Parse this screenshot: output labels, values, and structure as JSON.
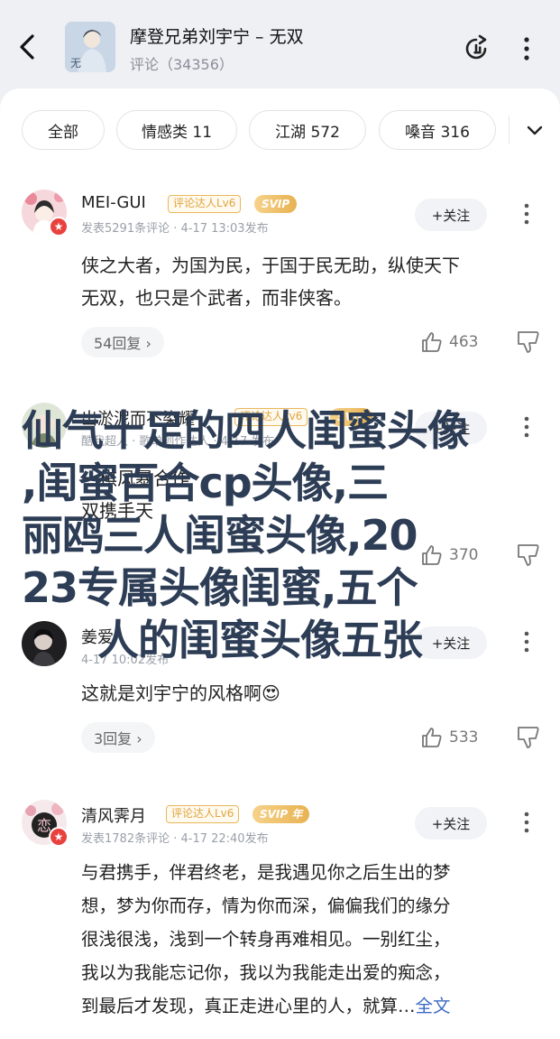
{
  "header": {
    "title": "摩登兄弟刘宇宁 – 无双",
    "subtitle": "评论（34356）"
  },
  "filters": [
    {
      "label": "全部"
    },
    {
      "label": "情感类 11"
    },
    {
      "label": "江湖 572"
    },
    {
      "label": "嗓音 316"
    }
  ],
  "comments": [
    {
      "user": "MEI-GUI",
      "level_tag": "评论达人Lv6",
      "vip_tag": "SVIP",
      "meta": "发表5291条评论 · 4-17 13:03发布",
      "follow": "+关注",
      "text_lines": [
        "侠之大者，为国为民，于国于民无助，纵使天下",
        "无双，也只是个武者，而非侠客。"
      ],
      "replies": "54回复 ›",
      "likes": "463"
    },
    {
      "user": "出淤泥而不染耀",
      "level_tag": "评论达人Lv6",
      "vip_tag": "SVIP",
      "meta": "酷我超人 · 歌单创作达人 · 4-17 发布",
      "follow": "+关注",
      "text_lines": [
        "一棋风暴合作",
        "双携手天"
      ],
      "replies": "",
      "likes": "370"
    },
    {
      "user": "姜爱",
      "level_tag": "",
      "vip_tag": "",
      "meta": "4-17 10:02发布",
      "follow": "+关注",
      "text_lines": [
        "这就是刘宇宁的风格啊😍"
      ],
      "replies": "3回复 ›",
      "likes": "533"
    },
    {
      "user": "清风霁月",
      "level_tag": "评论达人Lv6",
      "vip_tag": "SVIP 年",
      "meta": "发表1782条评论 · 4-17 22:40发布",
      "follow": "+关注",
      "text_lines": [
        "与君携手，伴君终老，是我遇见你之后生出的梦",
        "想，梦为你而存，情为你而深，偏偏我们的缘分",
        "很浅很浅，浅到一个转身再难相见。一别红尘，",
        "我以为我能忘记你，我以为我能走出爱的痴念，",
        "到最后才发现，真正走进心里的人，就算…"
      ],
      "full_link": "全文",
      "replies": "",
      "likes": ""
    }
  ],
  "overlay": {
    "lines": [
      "仙气十足的四人闺蜜头像",
      ",闺蜜百合cp头像,三",
      "丽鸥三人闺蜜头像,20",
      "23专属头像闺蜜,五个",
      "人的闺蜜头像五张"
    ],
    "color": "#2d3d55"
  }
}
